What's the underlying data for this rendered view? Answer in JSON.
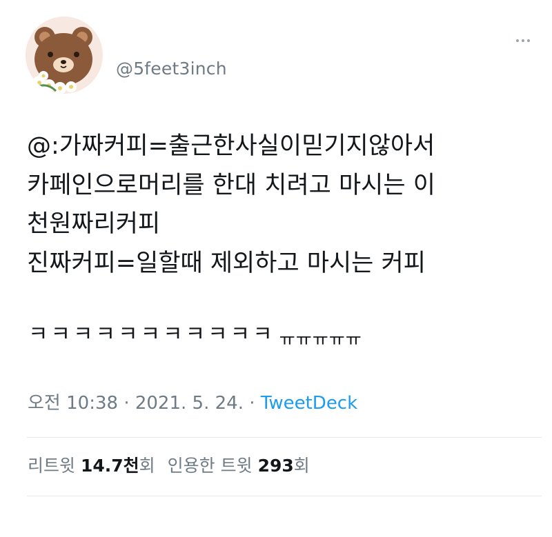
{
  "tweet": {
    "handle": "@5feet3inch",
    "body_lines": [
      "@:가짜커피=출근한사실이믿기지않아서",
      "카페인으로머리를 한대 치려고 마시는 이",
      "천원짜리커피",
      "진짜커피=일할때 제외하고 마시는 커피"
    ],
    "laugh_text": "ㅋㅋㅋㅋㅋㅋㅋㅋㅋㅋㅋ",
    "cry_text": "ㅠㅠㅠㅠㅠ",
    "time": "오전 10:38",
    "separator": "·",
    "date": "2021. 5. 24.",
    "source": "TweetDeck",
    "retweets_label": "리트윗",
    "retweets_count": "14.7천",
    "retweets_suffix": "회",
    "quotes_label": "인용한 트윗",
    "quotes_count": "293",
    "quotes_suffix": "회"
  },
  "icons": {
    "avatar": "bear-avatar-icon",
    "more": "more-dots-icon"
  },
  "colors": {
    "text_primary": "#14171a",
    "text_secondary": "#6e7b85",
    "link": "#1d9bf0",
    "divider": "#e3e8ec"
  }
}
